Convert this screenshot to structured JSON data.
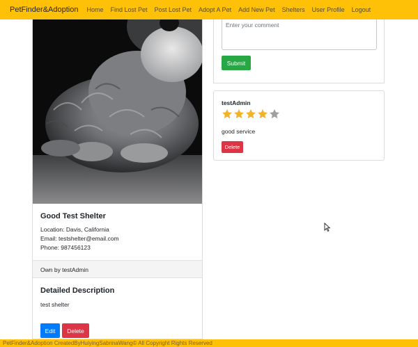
{
  "navbar": {
    "brand": "PetFinder&Adoption",
    "links": [
      {
        "label": "Home"
      },
      {
        "label": "Find Lost Pet"
      },
      {
        "label": "Post Lost Pet"
      },
      {
        "label": "Adopt A Pet"
      },
      {
        "label": "Add New Pet"
      },
      {
        "label": "Shelters"
      },
      {
        "label": "User Profile"
      },
      {
        "label": "Logout"
      }
    ],
    "color": "#ffc107"
  },
  "shelter": {
    "photo_icon": "schnauzer-dog-photo",
    "name": "Good Test Shelter",
    "location": "Location: Davis, California",
    "email": "Email: testshelter@email.com",
    "phone": "Phone: 987456123",
    "owner": "Own by testAdmin",
    "description_title": "Detailed Description",
    "description": "test shelter",
    "edit_label": "Edit",
    "delete_label": "Delete"
  },
  "comment_form": {
    "placeholder": "Enter your comment",
    "submit_label": "Submit"
  },
  "reviews": [
    {
      "author": "testAdmin",
      "rating": 4,
      "max_rating": 5,
      "text": "good service",
      "delete_label": "Delete"
    }
  ],
  "colors": {
    "primary": "#007bff",
    "danger": "#dc3545",
    "success": "#28a745",
    "star_filled": "#f0b429",
    "star_empty": "#a0a0a0"
  },
  "footer": {
    "text": "PetFinder&Adoption CreatedByHuiyingSabrinaWang© All Copyright Rights Reserved"
  }
}
